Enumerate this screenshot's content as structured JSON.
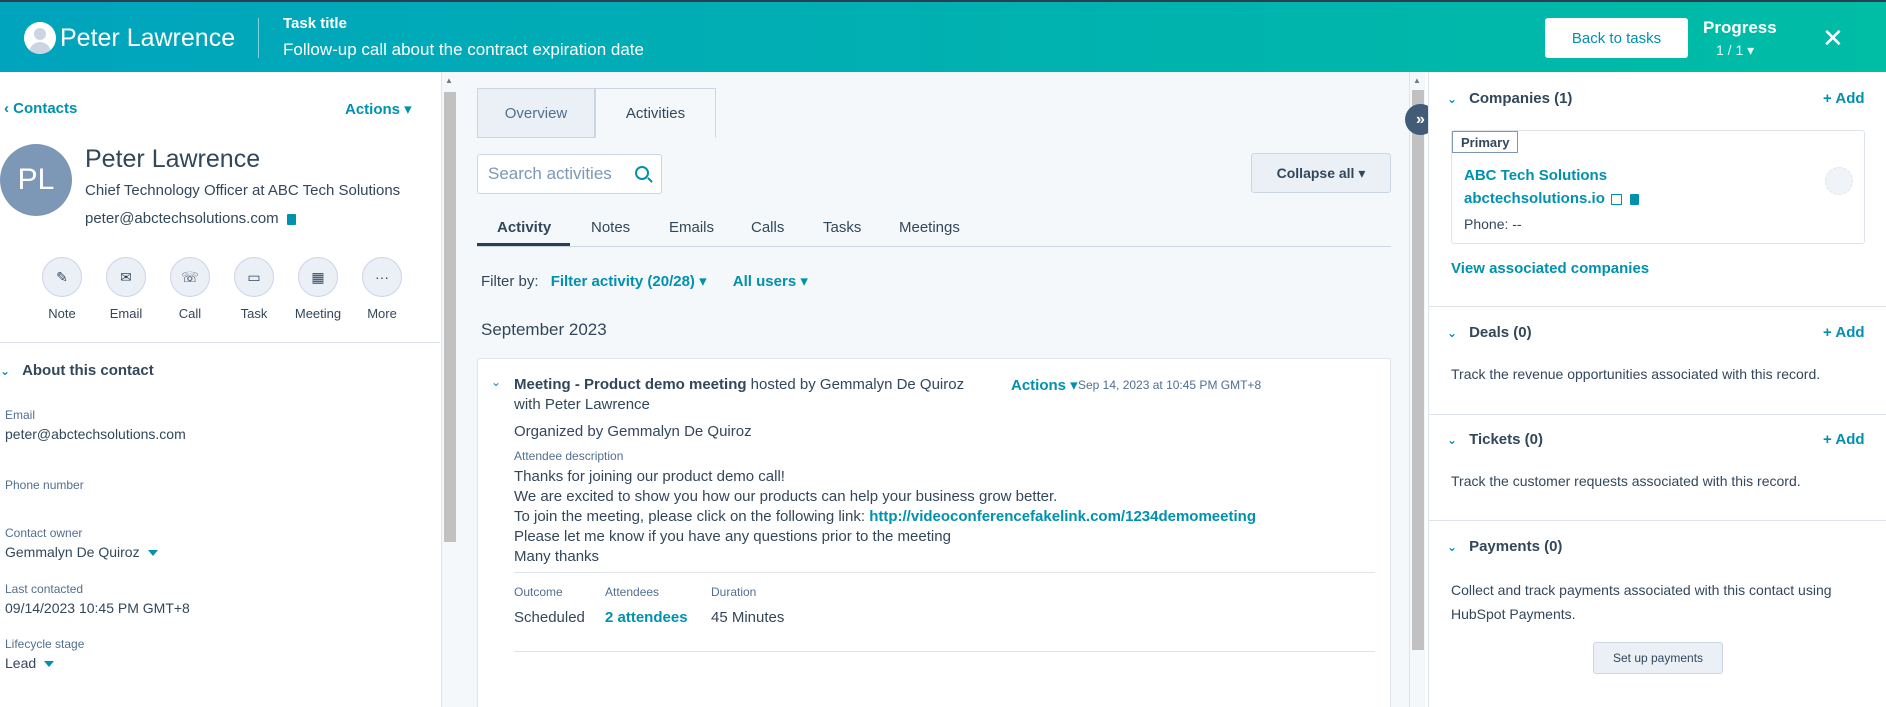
{
  "header": {
    "contact_name": "Peter Lawrence",
    "task_label": "Task title",
    "task_title": "Follow-up call about the contract expiration date",
    "back_button": "Back to tasks",
    "progress_label": "Progress",
    "progress_value": "1 / 1 ▾",
    "close": "✕"
  },
  "left": {
    "contacts_link": "‹  Contacts",
    "actions": "Actions ▾",
    "initials": "PL",
    "name": "Peter Lawrence",
    "role": "Chief Technology Officer at ABC Tech Solutions",
    "email": "peter@abctechsolutions.com",
    "quick_actions": [
      {
        "label": "Note",
        "icon": "✎"
      },
      {
        "label": "Email",
        "icon": "✉"
      },
      {
        "label": "Call",
        "icon": "☏"
      },
      {
        "label": "Task",
        "icon": "▭"
      },
      {
        "label": "Meeting",
        "icon": "▦"
      },
      {
        "label": "More",
        "icon": "···"
      }
    ],
    "about_title": "About this contact",
    "fields": {
      "email_label": "Email",
      "email_value": "peter@abctechsolutions.com",
      "phone_label": "Phone number",
      "owner_label": "Contact owner",
      "owner_value": "Gemmalyn De Quiroz",
      "last_contacted_label": "Last contacted",
      "last_contacted_value": "09/14/2023 10:45 PM GMT+8",
      "lifecycle_label": "Lifecycle stage",
      "lifecycle_value": "Lead"
    }
  },
  "middle": {
    "tabs": [
      "Overview",
      "Activities"
    ],
    "search_placeholder": "Search activities",
    "collapse_all": "Collapse all ▾",
    "subtabs": [
      "Activity",
      "Notes",
      "Emails",
      "Calls",
      "Tasks",
      "Meetings"
    ],
    "filter_by": "Filter by:",
    "filter_activity": "Filter activity (20/28) ▾",
    "all_users": "All users ▾",
    "month": "September 2023",
    "card": {
      "title_bold": "Meeting - Product demo meeting",
      "title_rest": " hosted by Gemmalyn De Quiroz",
      "with": "with Peter Lawrence",
      "actions": "Actions ▾",
      "date": "Sep 14, 2023 at 10:45 PM GMT+8",
      "organized": "Organized by Gemmalyn De Quiroz",
      "attendee_desc_label": "Attendee description",
      "line1": "Thanks for joining our product demo call!",
      "line2": "We are excited to show you how our products can help your business grow better.",
      "line3_prefix": "To join the meeting, please click on the following link: ",
      "line3_link": "http://videoconferencefakelink.com/1234demomeeting",
      "line4": "Please let me know if you have any questions prior to the meeting",
      "line5": "Many thanks",
      "outcome_label": "Outcome",
      "outcome_value": "Scheduled",
      "attendees_label": "Attendees",
      "attendees_value": "2 attendees",
      "duration_label": "Duration",
      "duration_value": "45 Minutes"
    }
  },
  "right": {
    "companies_title": "Companies (1)",
    "add": "+ Add",
    "primary_tag": "Primary",
    "company_name": "ABC Tech Solutions",
    "company_domain": "abctechsolutions.io",
    "company_phone": "Phone: --",
    "view_associated": "View associated companies",
    "deals_title": "Deals (0)",
    "deals_text": "Track the revenue opportunities associated with this record.",
    "tickets_title": "Tickets (0)",
    "tickets_text": "Track the customer requests associated with this record.",
    "payments_title": "Payments (0)",
    "payments_text_1": "Collect and track payments associated with this contact using",
    "payments_text_2": "HubSpot Payments.",
    "setup_payments": "Set up payments"
  }
}
